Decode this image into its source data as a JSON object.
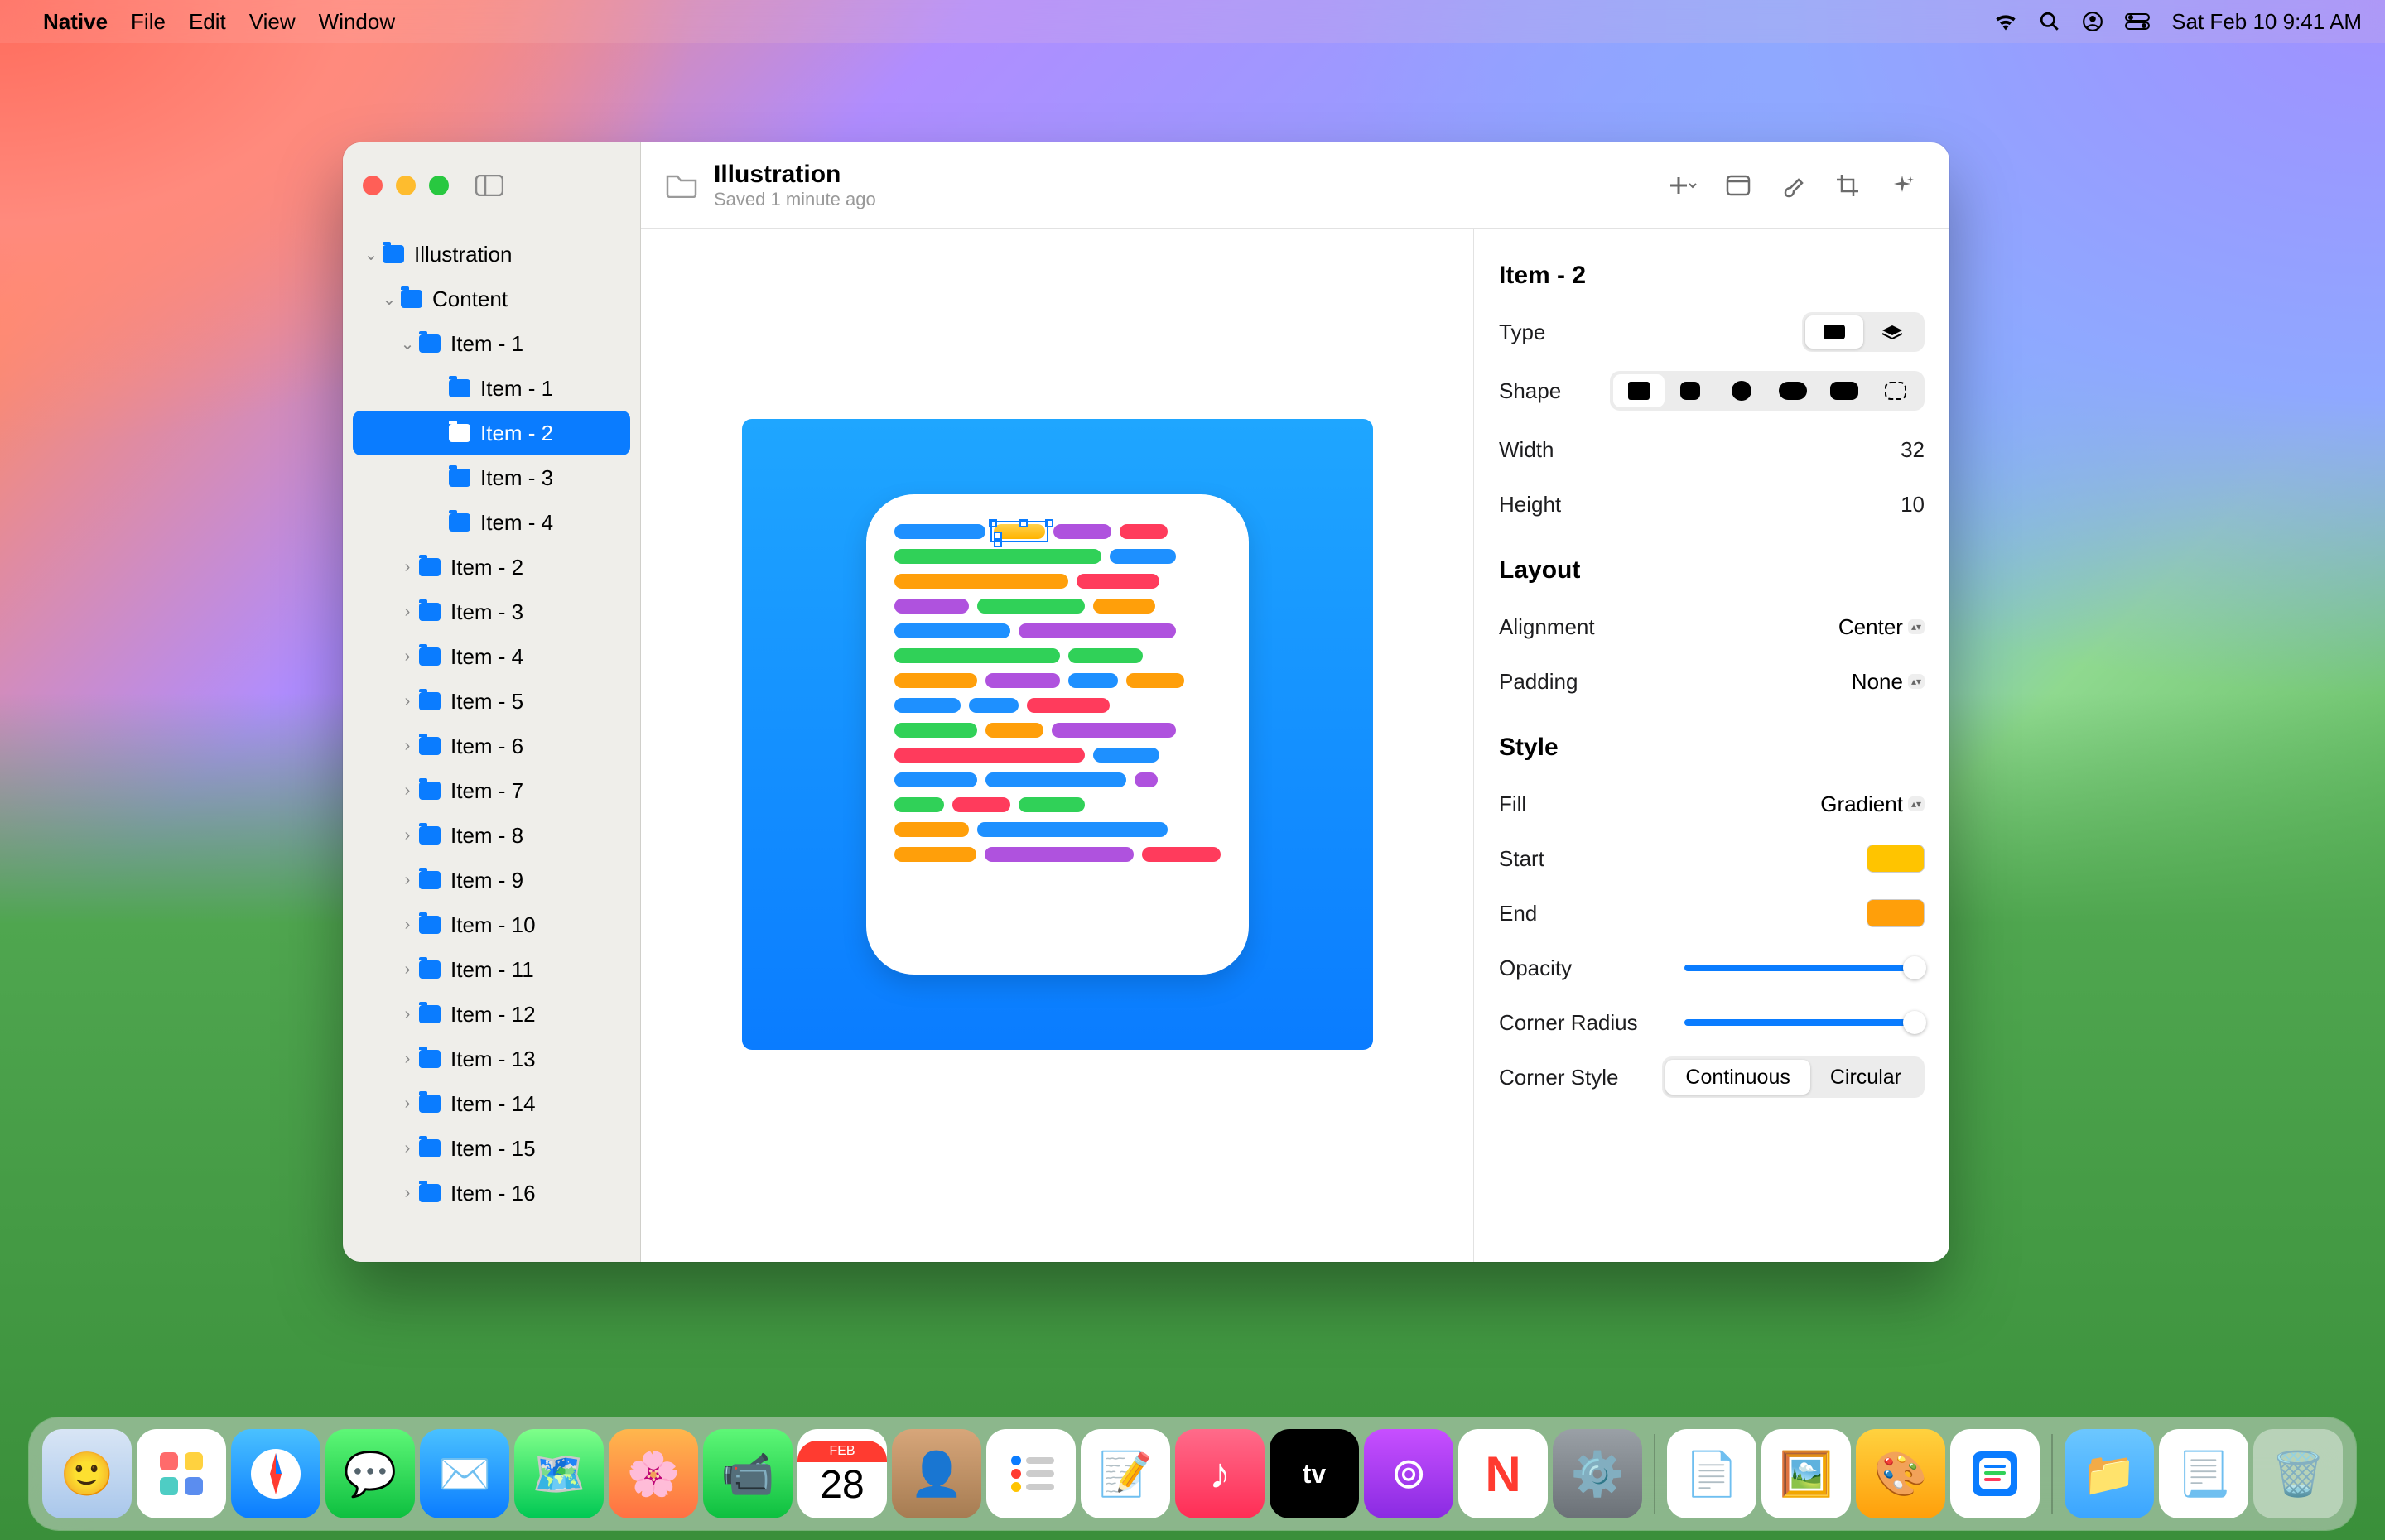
{
  "menubar": {
    "app_name": "Native",
    "items": [
      "File",
      "Edit",
      "View",
      "Window"
    ],
    "date": "Sat Feb 10 9:41 AM"
  },
  "window": {
    "title": "Illustration",
    "subtitle": "Saved 1 minute ago",
    "tree": {
      "root": "Illustration",
      "content": "Content",
      "item1": "Item - 1",
      "children": [
        "Item - 1",
        "Item - 2",
        "Item - 3",
        "Item - 4"
      ],
      "siblings": [
        "Item - 2",
        "Item - 3",
        "Item - 4",
        "Item - 5",
        "Item - 6",
        "Item - 7",
        "Item - 8",
        "Item - 9",
        "Item - 10",
        "Item - 11",
        "Item - 12",
        "Item - 13",
        "Item - 14",
        "Item - 15",
        "Item - 16"
      ],
      "selected": "Item - 2"
    }
  },
  "inspector": {
    "title": "Item - 2",
    "type_label": "Type",
    "shape_label": "Shape",
    "width_label": "Width",
    "width_value": "32",
    "height_label": "Height",
    "height_value": "10",
    "layout_header": "Layout",
    "alignment_label": "Alignment",
    "alignment_value": "Center",
    "padding_label": "Padding",
    "padding_value": "None",
    "style_header": "Style",
    "fill_label": "Fill",
    "fill_value": "Gradient",
    "start_label": "Start",
    "start_color": "#ffc400",
    "end_label": "End",
    "end_color": "#ff9f0a",
    "opacity_label": "Opacity",
    "radius_label": "Corner Radius",
    "cs_label": "Corner Style",
    "cs_continuous": "Continuous",
    "cs_circular": "Circular"
  },
  "colors": {
    "blue": "#1e90ff",
    "green": "#30d158",
    "purple": "#af52de",
    "orange": "#ff9f0a",
    "red": "#ff3b5c",
    "yellow": "#ffc800"
  }
}
